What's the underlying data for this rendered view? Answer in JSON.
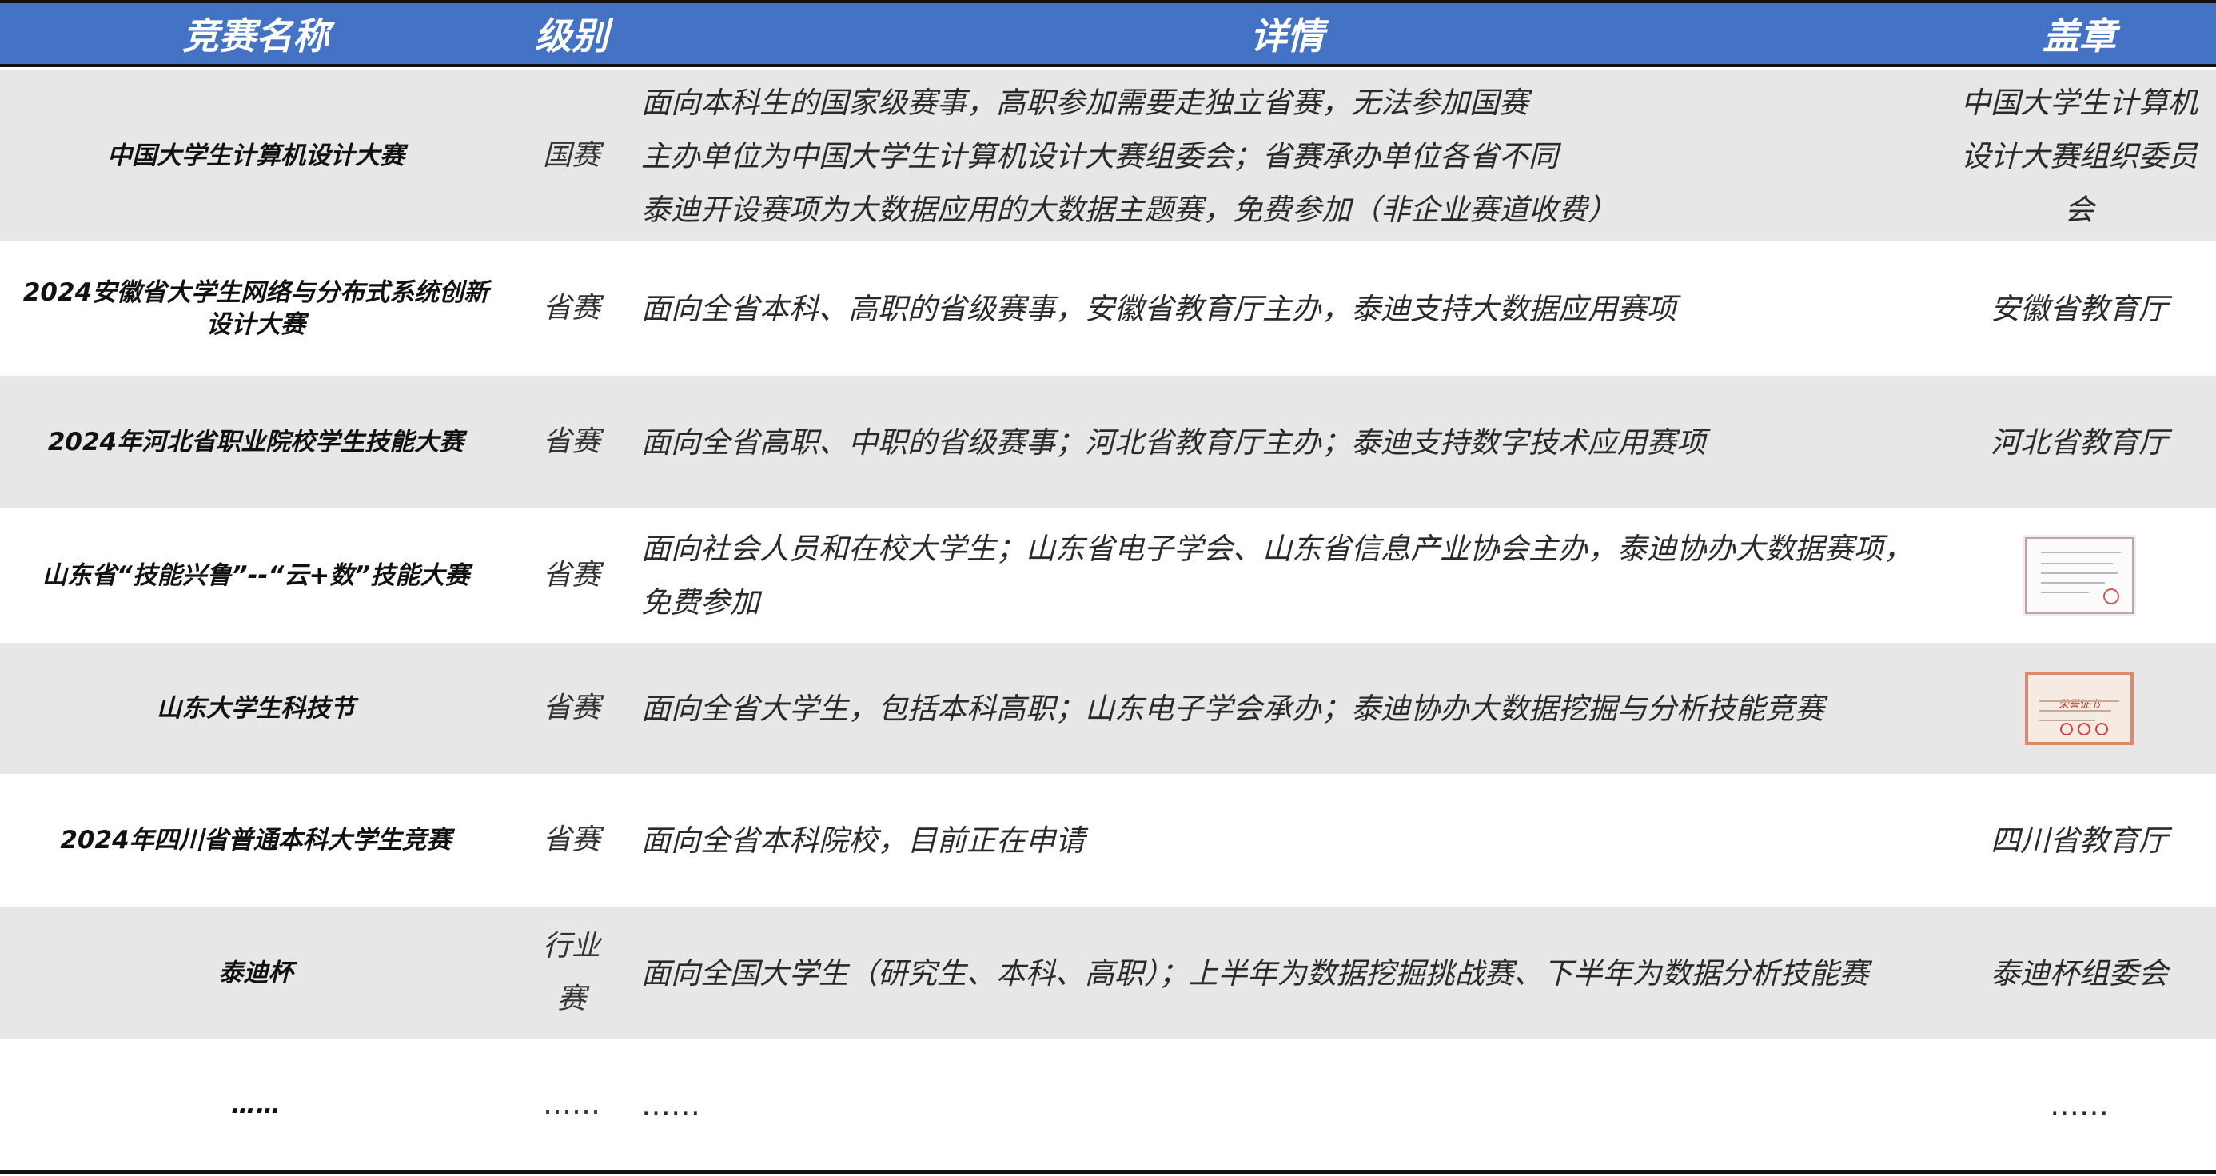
{
  "headers": {
    "name": "竞赛名称",
    "level": "级别",
    "detail": "详情",
    "seal": "盖章"
  },
  "rows": [
    {
      "name": "中国大学生计算机设计大赛",
      "level": "国赛",
      "detail": [
        "面向本科生的国家级赛事，高职参加需要走独立省赛，无法参加国赛",
        "主办单位为中国大学生计算机设计大赛组委会；省赛承办单位各省不同",
        "泰迪开设赛项为大数据应用的大数据主题赛，免费参加（非企业赛道收费）"
      ],
      "seal": "中国大学生计算机设计大赛组织委员会"
    },
    {
      "name": "2024安徽省大学生网络与分布式系统创新设计大赛",
      "level": "省赛",
      "detail": [
        "面向全省本科、高职的省级赛事，安徽省教育厅主办，泰迪支持大数据应用赛项"
      ],
      "seal": "安徽省教育厅"
    },
    {
      "name": "2024年河北省职业院校学生技能大赛",
      "level": "省赛",
      "detail": [
        "面向全省高职、中职的省级赛事；河北省教育厅主办；泰迪支持数字技术应用赛项"
      ],
      "seal": "河北省教育厅"
    },
    {
      "name": "山东省“技能兴鲁”--“云+数”技能大赛",
      "level": "省赛",
      "detail": [
        "面向社会人员和在校大学生；山东省电子学会、山东省信息产业协会主办，泰迪协办大数据赛项，免费参加"
      ],
      "seal": ""
    },
    {
      "name": "山东大学生科技节",
      "level": "省赛",
      "detail": [
        "面向全省大学生，包括本科高职；山东电子学会承办；泰迪协办大数据挖掘与分析技能竞赛"
      ],
      "seal": ""
    },
    {
      "name": "2024年四川省普通本科大学生竞赛",
      "level": "省赛",
      "detail": [
        "面向全省本科院校，目前正在申请"
      ],
      "seal": "四川省教育厅"
    },
    {
      "name": "泰迪杯",
      "level": "行业赛",
      "detail": [
        "面向全国大学生（研究生、本科、高职）；上半年为数据挖掘挑战赛、下半年为数据分析技能赛"
      ],
      "seal": "泰迪杯组委会"
    },
    {
      "name": "……",
      "level": "……",
      "detail": [
        "……"
      ],
      "seal": "……"
    }
  ],
  "certificate_titles": [
    "荣誉证书"
  ],
  "colors": {
    "header_bg": "#4472c4",
    "row_shade": "#e7e7e7",
    "rule": "#111111"
  }
}
